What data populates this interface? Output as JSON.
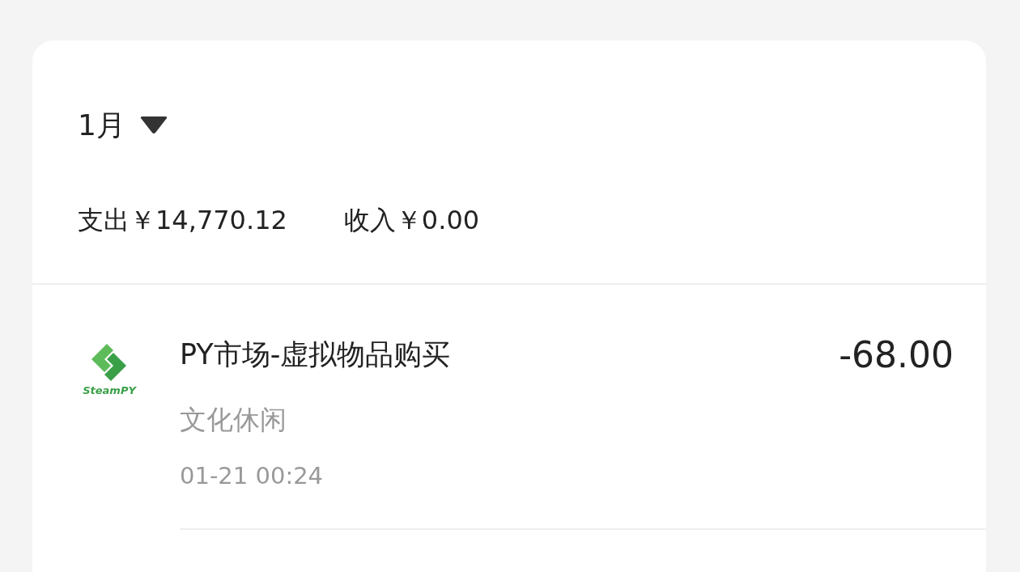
{
  "header": {
    "month": "1月"
  },
  "summary": {
    "expense": "支出￥14,770.12",
    "income": "收入￥0.00"
  },
  "transactions": [
    {
      "merchant": "PY市场-虚拟物品购买",
      "logo_text": "SteamPY",
      "amount": "-68.00",
      "category": "文化休闲",
      "time": "01-21 00:24"
    }
  ]
}
